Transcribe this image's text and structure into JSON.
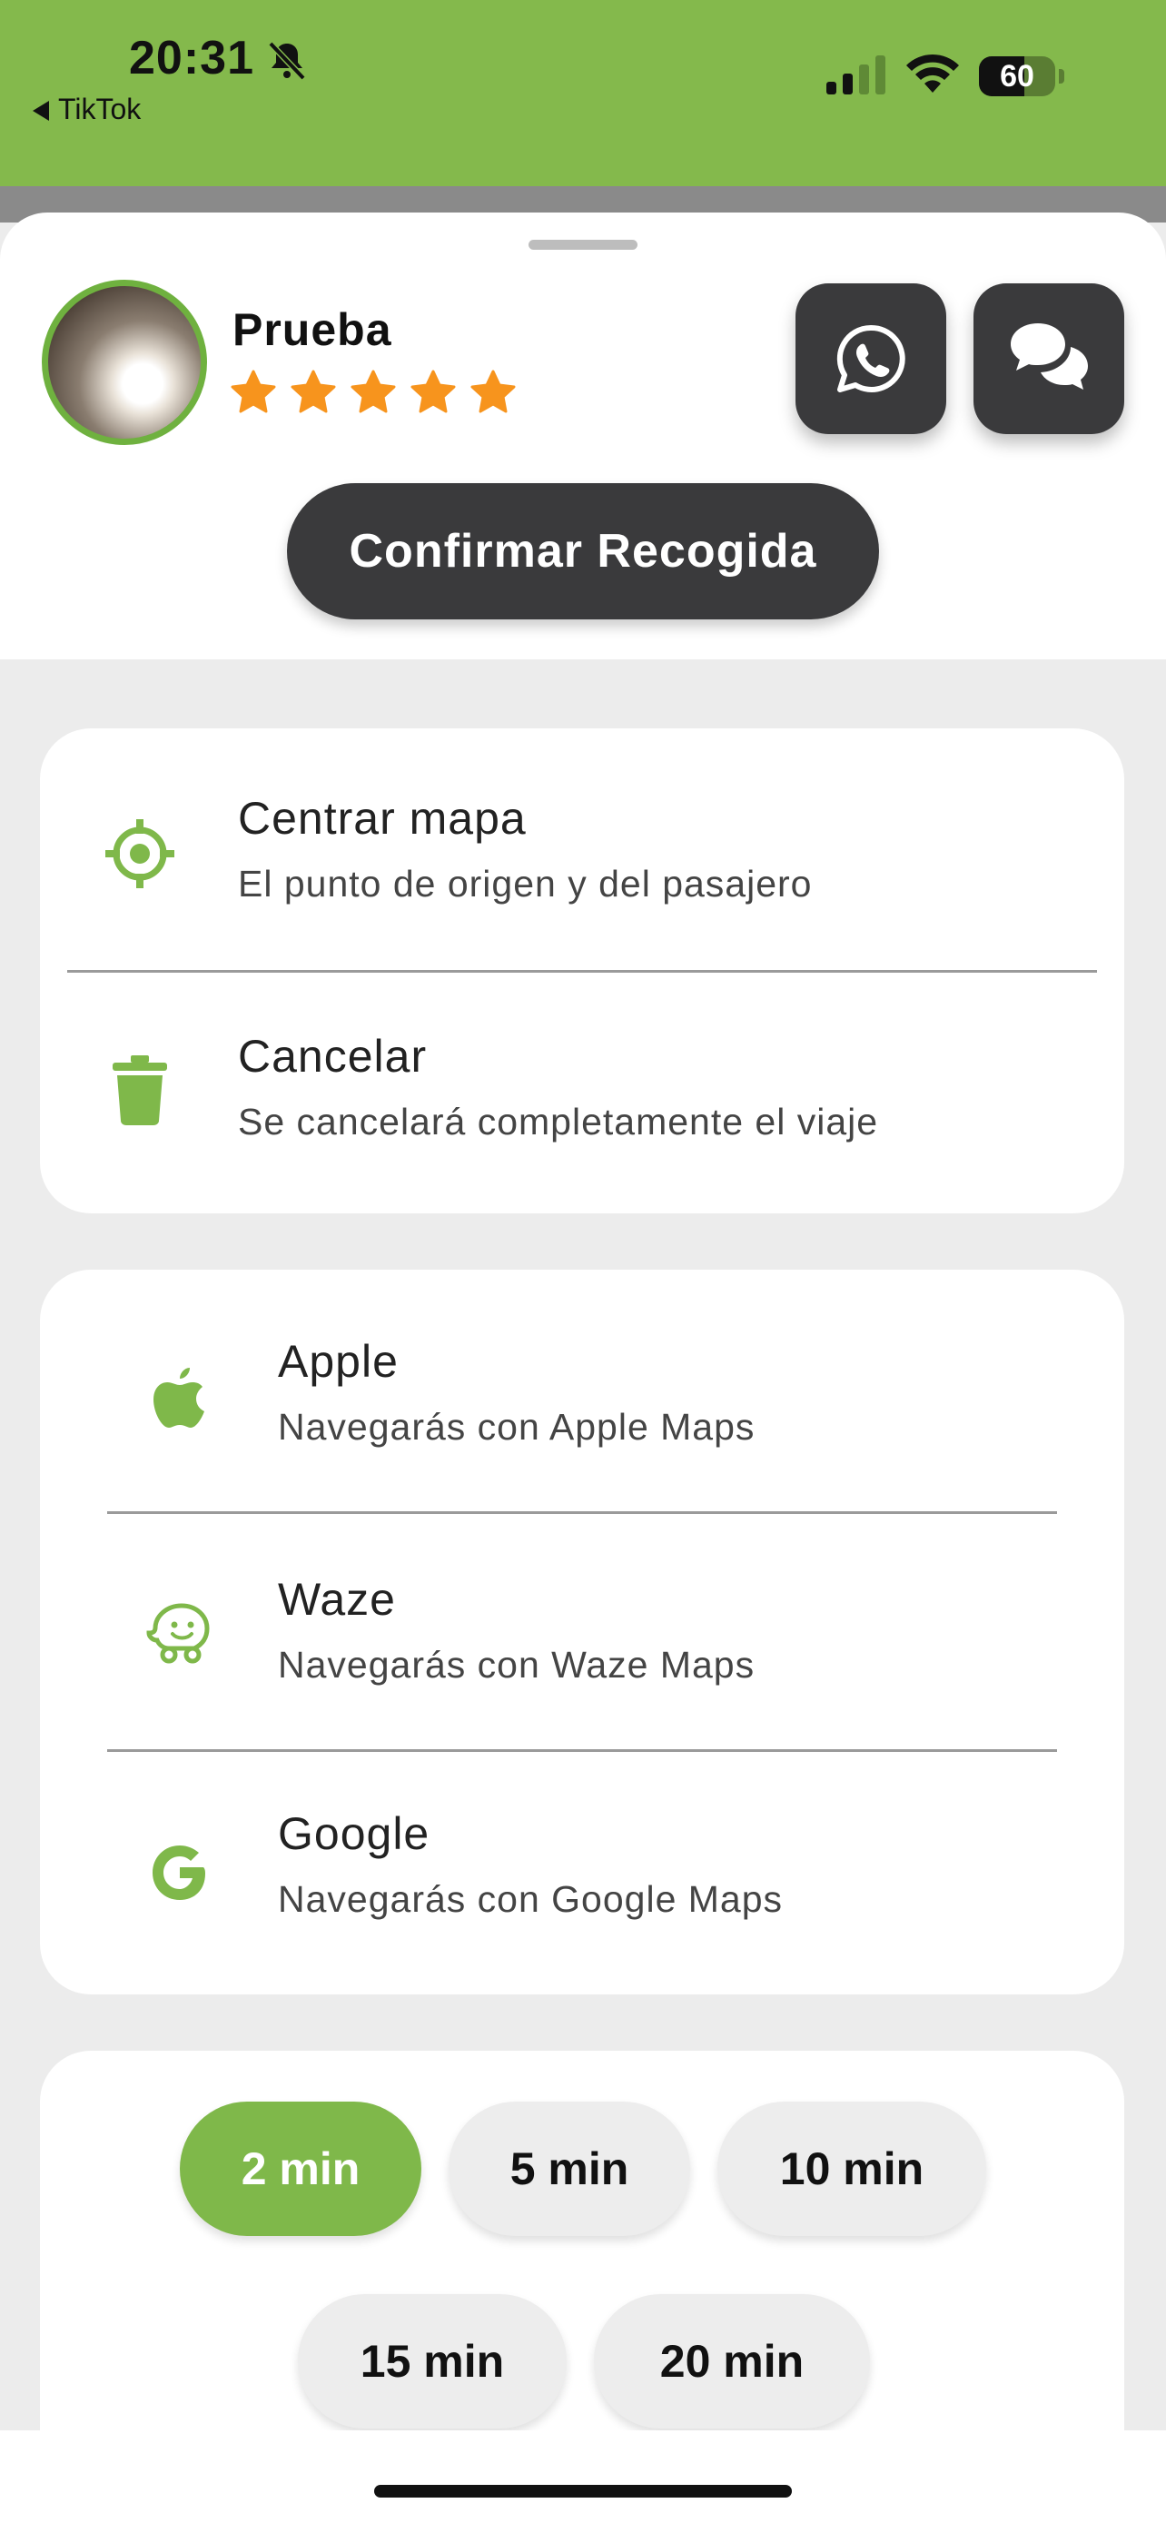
{
  "status_bar": {
    "time": "20:31",
    "back_app": "TikTok",
    "battery": "60",
    "battery_level": 0.6
  },
  "driver": {
    "name": "Prueba",
    "rating": 5,
    "max_rating": 5
  },
  "actions": {
    "whatsapp_icon": "whatsapp-icon",
    "chat_icon": "chat-bubbles-icon",
    "confirm_label": "Confirmar Recogida"
  },
  "options": [
    {
      "title": "Centrar mapa",
      "subtitle": "El punto de origen y del pasajero",
      "icon": "crosshair-icon"
    },
    {
      "title": "Cancelar",
      "subtitle": "Se cancelará completamente el viaje",
      "icon": "trash-icon"
    }
  ],
  "navigation": [
    {
      "title": "Apple",
      "subtitle": "Navegarás con Apple Maps",
      "icon": "apple-icon"
    },
    {
      "title": "Waze",
      "subtitle": "Navegarás con Waze Maps",
      "icon": "waze-icon"
    },
    {
      "title": "Google",
      "subtitle": "Navegarás con Google Maps",
      "icon": "google-icon"
    }
  ],
  "wait_times": [
    {
      "label": "2 min",
      "selected": true
    },
    {
      "label": "5 min",
      "selected": false
    },
    {
      "label": "10 min",
      "selected": false
    },
    {
      "label": "15 min",
      "selected": false
    },
    {
      "label": "20 min",
      "selected": false
    }
  ],
  "colors": {
    "accent": "#7fb84a",
    "status_bar": "#84b94c",
    "dark_button": "#3a3a3c",
    "star": "#f7941d"
  }
}
